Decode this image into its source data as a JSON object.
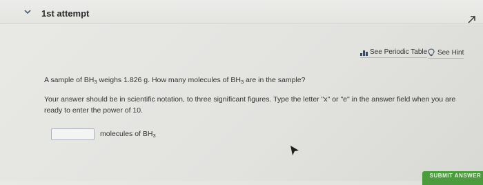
{
  "header": {
    "attempt_title": "1st attempt"
  },
  "tools": {
    "periodic_table_label": "See Periodic Table",
    "hint_label": "See Hint"
  },
  "question": {
    "prefix": "A sample of BH",
    "sub1": "3",
    "mid": " weighs 1.826 g. How many molecules of BH",
    "sub2": "3",
    "suffix": " are in the sample?"
  },
  "instructions": "Your answer should be in scientific notation, to three significant figures. Type the letter \"x\" or \"e\" in the answer field when you are ready to enter the power of 10.",
  "answer": {
    "value": "",
    "unit_prefix": "molecules of BH",
    "unit_sub": "3"
  },
  "submit": {
    "label": "SUBMIT ANSWER"
  },
  "colors": {
    "accent": "#4d9b3f",
    "text": "#333333"
  }
}
